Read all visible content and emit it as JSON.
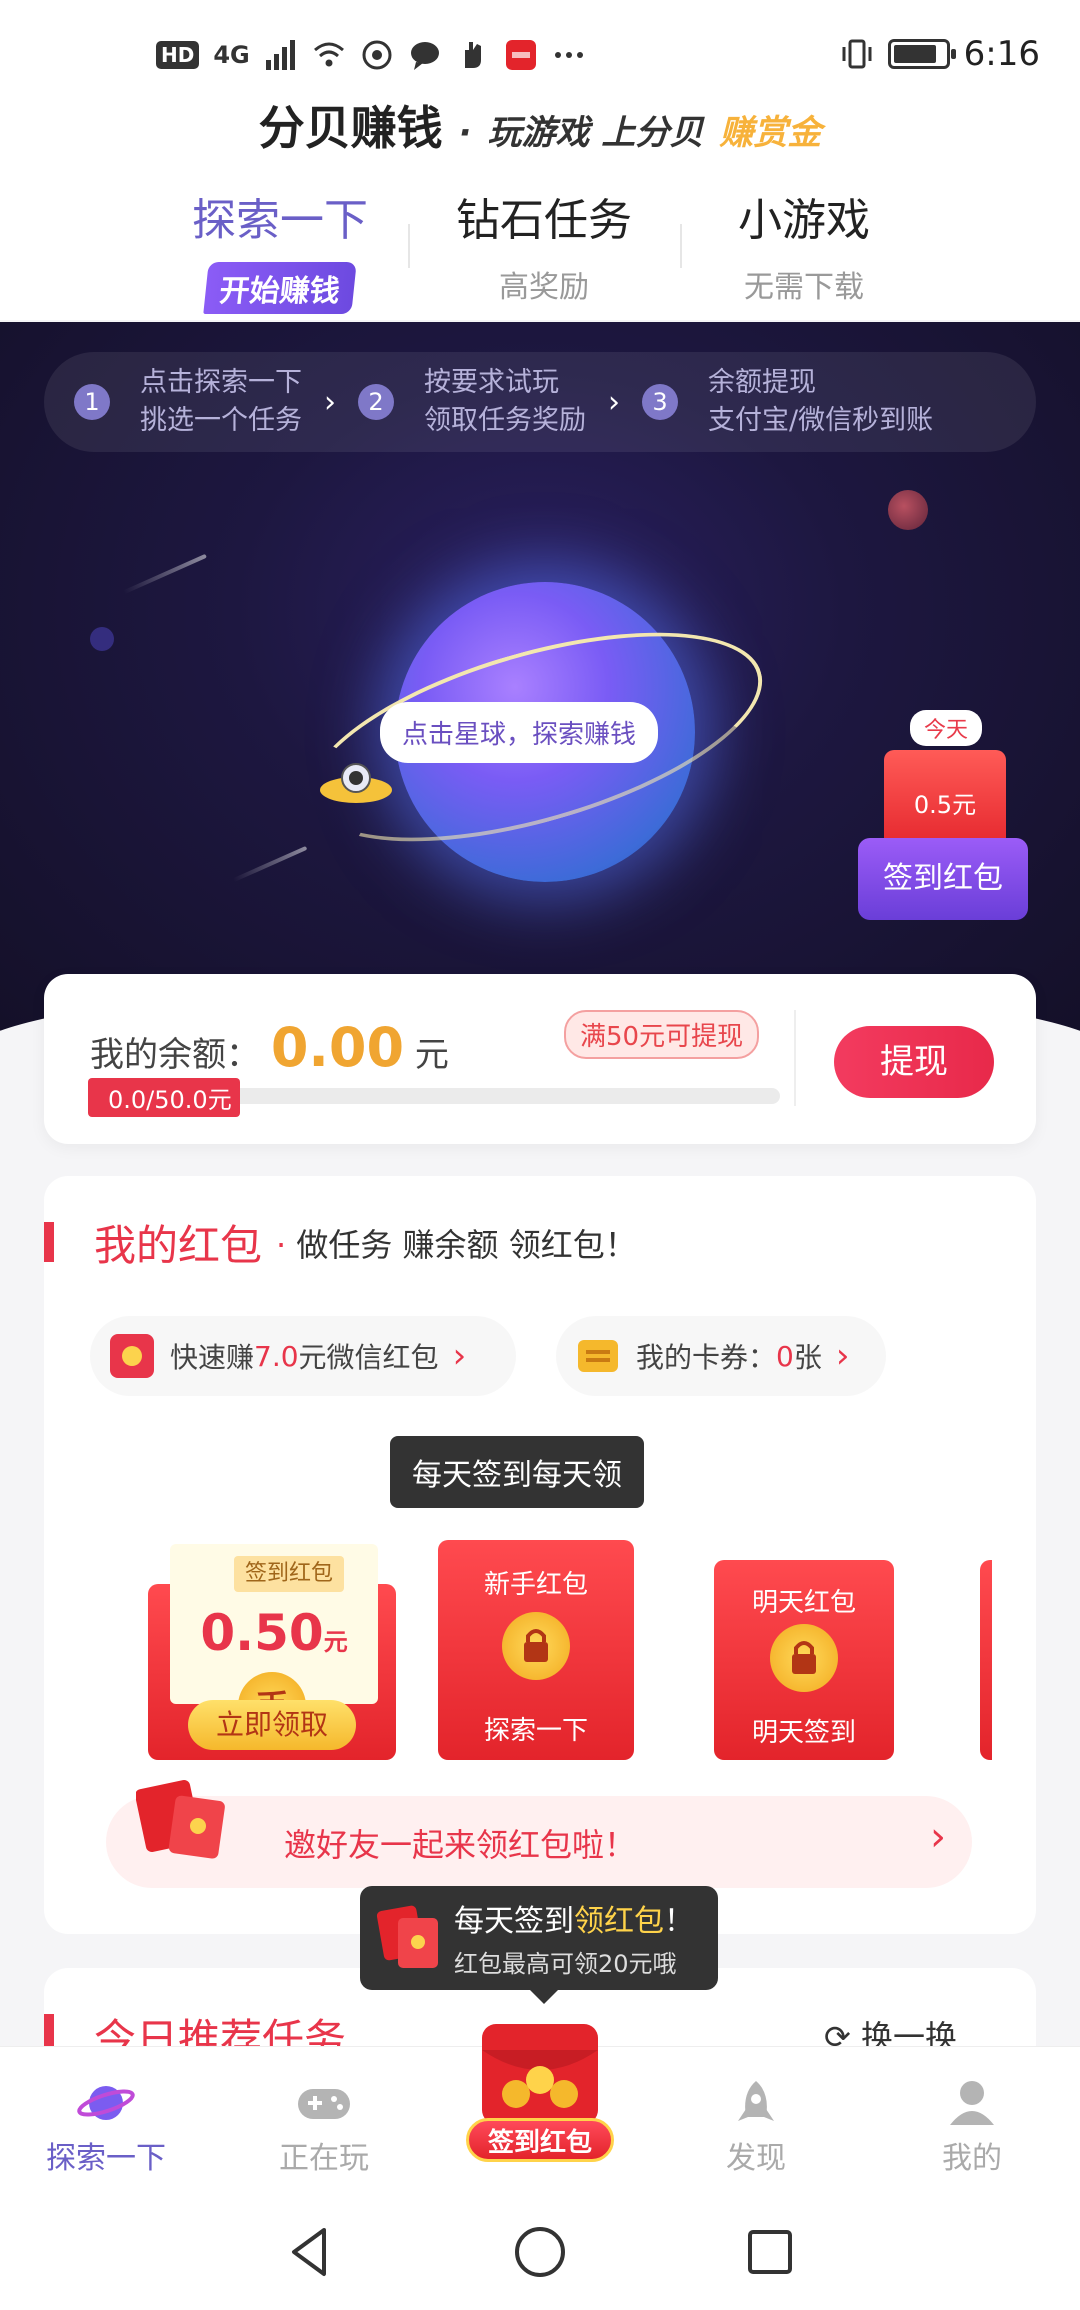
{
  "status_bar": {
    "network_badge": "HD",
    "signal_text": "4G",
    "time": "6:16",
    "icons": [
      "signal-icon",
      "wifi-icon",
      "location-icon",
      "chat-icon",
      "hand-icon",
      "huawei-icon",
      "more-icon",
      "vibrate-icon",
      "battery-icon"
    ]
  },
  "header": {
    "brand": "分贝赚钱",
    "dot": "·",
    "slogan": "玩游戏 上分贝",
    "slogan_highlight": "赚赏金",
    "tabs": [
      {
        "label": "探索一下",
        "sub": "开始赚钱",
        "active": true
      },
      {
        "label": "钻石任务",
        "sub": "高奖励",
        "active": false
      },
      {
        "label": "小游戏",
        "sub": "无需下载",
        "active": false
      }
    ]
  },
  "hero": {
    "steps": [
      {
        "num": "1",
        "line1": "点击探索一下",
        "line2": "挑选一个任务"
      },
      {
        "num": "2",
        "line1": "按要求试玩",
        "line2": "领取任务奖励"
      },
      {
        "num": "3",
        "line1": "余额提现",
        "line2": "支付宝/微信秒到账"
      }
    ],
    "step_arrow": "›",
    "planet_bubble": "点击星球，探索赚钱",
    "signin_widget": {
      "tag": "今天",
      "amount": "0.5",
      "unit": "元",
      "label": "签到红包"
    }
  },
  "balance": {
    "label": "我的余额：",
    "value": "0.00",
    "unit": "元",
    "tip": "满50元可提现",
    "progress_text": "0.0/50.0元",
    "progress_fraction": 0.0,
    "withdraw_button": "提现"
  },
  "red_packets": {
    "title": "我的红包",
    "dot": "·",
    "subtitle": "做任务  赚余额  领红包！",
    "chip1": {
      "prefix": "快速赚",
      "amount": "7.0",
      "suffix": "元微信红包",
      "arrow": "›"
    },
    "chip2": {
      "prefix": "我的卡券：",
      "amount": "0",
      "suffix": "张",
      "arrow": "›"
    },
    "tooltip": "每天签到每天领",
    "packets": [
      {
        "tag": "签到红包",
        "amount": "0.50",
        "unit": "元",
        "coin": "币",
        "button": "立即领取"
      },
      {
        "title": "新手红包",
        "bottom": "探索一下"
      },
      {
        "title": "明天红包",
        "bottom": "明天签到"
      }
    ],
    "invite": {
      "text": "邀好友一起来领红包啦！",
      "arrow": "›"
    }
  },
  "today_tasks": {
    "title": "今日推荐任务",
    "refresh": "换一换"
  },
  "signin_bubble": {
    "line1_prefix": "每天签到",
    "line1_highlight": "领红包",
    "line1_suffix": "！",
    "line2": "红包最高可领20元哦"
  },
  "bottom_nav": [
    {
      "label": "探索一下",
      "icon": "planet-icon",
      "active": true
    },
    {
      "label": "正在玩",
      "icon": "gamepad-icon",
      "active": false
    },
    {
      "label": "签到红包",
      "icon": "red-envelope-icon",
      "active": false
    },
    {
      "label": "发现",
      "icon": "rocket-icon",
      "active": false
    },
    {
      "label": "我的",
      "icon": "profile-icon",
      "active": false
    }
  ],
  "colors": {
    "accent_purple": "#6a5fc7",
    "accent_red": "#e8354a",
    "gold": "#f0a531",
    "hero_bg": "#1d1740"
  }
}
